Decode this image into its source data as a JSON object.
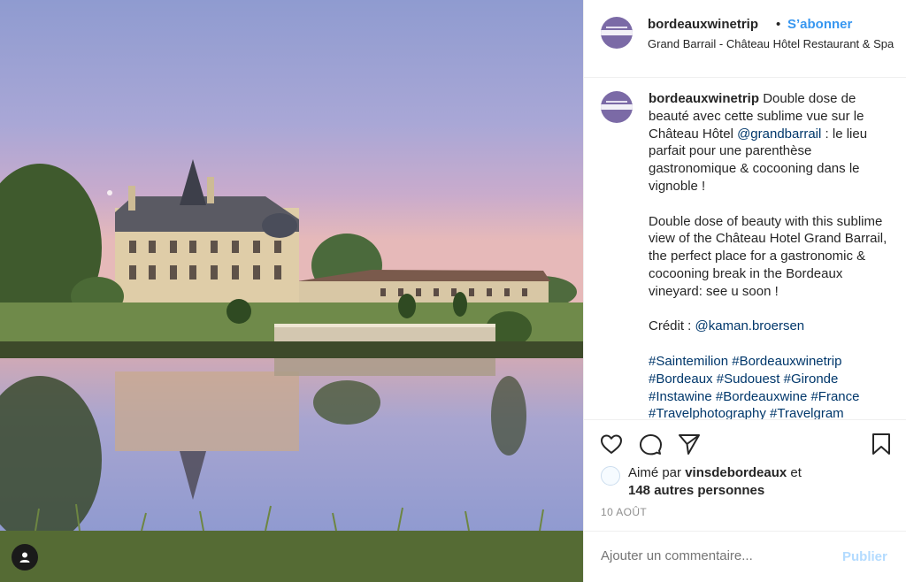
{
  "post": {
    "username": "bordeauxwinetrip",
    "separator": "•",
    "follow_label": "S’abonner",
    "location": "Grand Barrail - Château Hôtel Restaurant & Spa",
    "caption": {
      "username": "bordeauxwinetrip",
      "fr_1": "Double dose de beauté avec cette sublime vue sur le Château Hôtel",
      "fr_mention": "@grandbarrail",
      "fr_2": ": le lieu parfait pour une parenthèse gastronomique & cocooning dans le vignoble !",
      "en": "Double dose of beauty with this sublime view of the Château Hotel Grand Barrail, the perfect place for a gastronomic & cocooning break in the Bordeaux vineyard: see u soon !",
      "credit_label": "Crédit :",
      "credit_mention": "@kaman.broersen",
      "hashtags": [
        "#Saintemilion",
        "#Bordeauxwinetrip",
        "#Bordeaux",
        "#Sudouest",
        "#Gironde",
        "#Instawine",
        "#Bordeauxwine",
        "#France",
        "#Travelphotography",
        "#Travelgram"
      ]
    },
    "actions": {
      "like_icon": "heart-icon",
      "comment_icon": "comment-icon",
      "share_icon": "paper-plane-icon",
      "save_icon": "bookmark-icon"
    },
    "likes": {
      "prefix": "Aimé par",
      "liker": "vinsdebordeaux",
      "conj": "et",
      "others": "148 autres personnes"
    },
    "date": "10 AOÛT",
    "comment": {
      "placeholder": "Ajouter un commentaire...",
      "publish_label": "Publier"
    }
  },
  "colors": {
    "link_blue": "#3897f0",
    "hashtag_blue": "#00376b",
    "publish_disabled": "#b3dbff",
    "muted": "#8e8e8e",
    "avatar_purple": "#7b6aa6"
  }
}
